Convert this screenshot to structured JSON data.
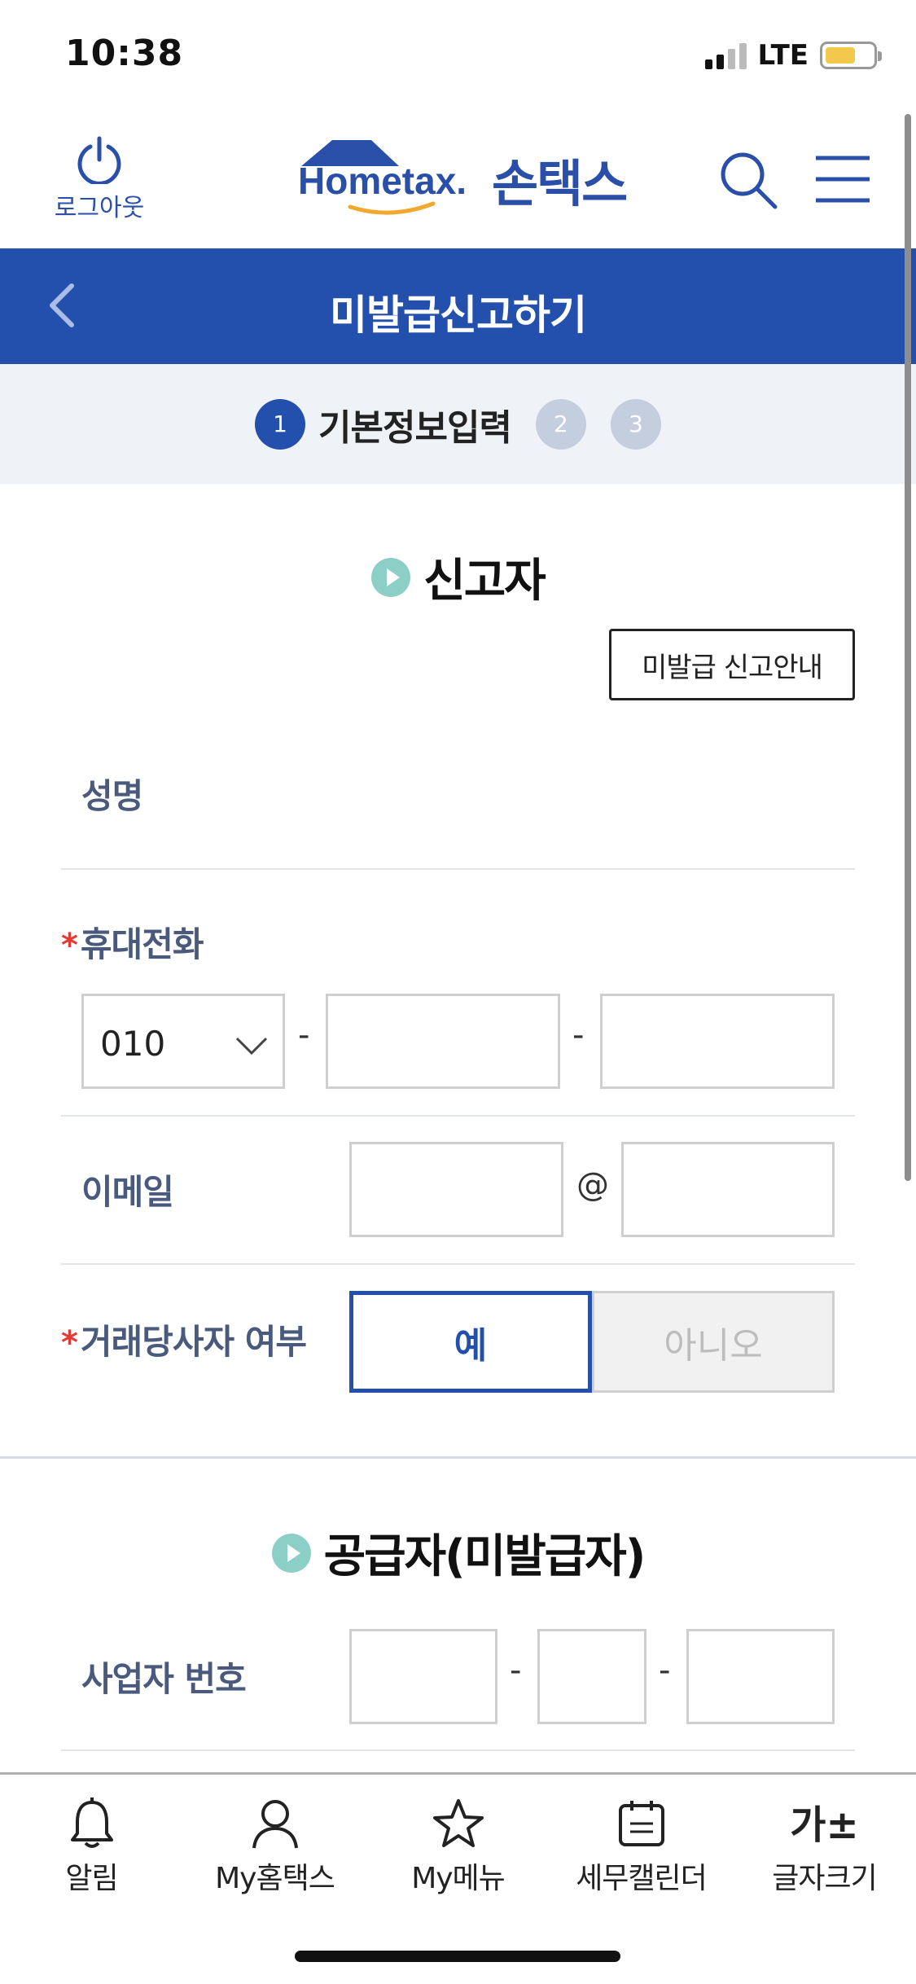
{
  "status_bar": {
    "time": "10:38",
    "network": "LTE"
  },
  "header": {
    "logout_label": "로그아웃",
    "brand_en": "Hometax.",
    "brand_ko": "손택스"
  },
  "title_bar": {
    "title": "미발급신고하기"
  },
  "steps": {
    "items": [
      {
        "number": "1",
        "label": "기본정보입력",
        "active": true
      },
      {
        "number": "2",
        "active": false
      },
      {
        "number": "3",
        "active": false
      }
    ]
  },
  "reporter_section": {
    "title": "신고자",
    "guide_button": "미발급 신고안내",
    "name_label": "성명",
    "phone_label": "휴대전화",
    "phone_prefix": "010",
    "phone_separator": "-",
    "email_label": "이메일",
    "email_at": "@",
    "party_label": "거래당사자 여부",
    "required_mark": "*",
    "yes_label": "예",
    "no_label": "아니오"
  },
  "supplier_section": {
    "title": "공급자(미발급자)",
    "bizno_label": "사업자 번호",
    "bizno_separator": "-"
  },
  "bottom_nav": {
    "items": [
      {
        "label": "알림",
        "icon": "bell-icon"
      },
      {
        "label": "My홈택스",
        "icon": "person-icon"
      },
      {
        "label": "My메뉴",
        "icon": "star-icon"
      },
      {
        "label": "세무캘린더",
        "icon": "calendar-icon"
      },
      {
        "label": "글자크기",
        "icon": "font-size-icon",
        "glyph": "가±"
      }
    ]
  },
  "colors": {
    "primary": "#2450ad",
    "step_inactive": "#c5cede",
    "bullet": "#8ccfc7",
    "required": "#e53935",
    "label": "#4a5a7d"
  }
}
